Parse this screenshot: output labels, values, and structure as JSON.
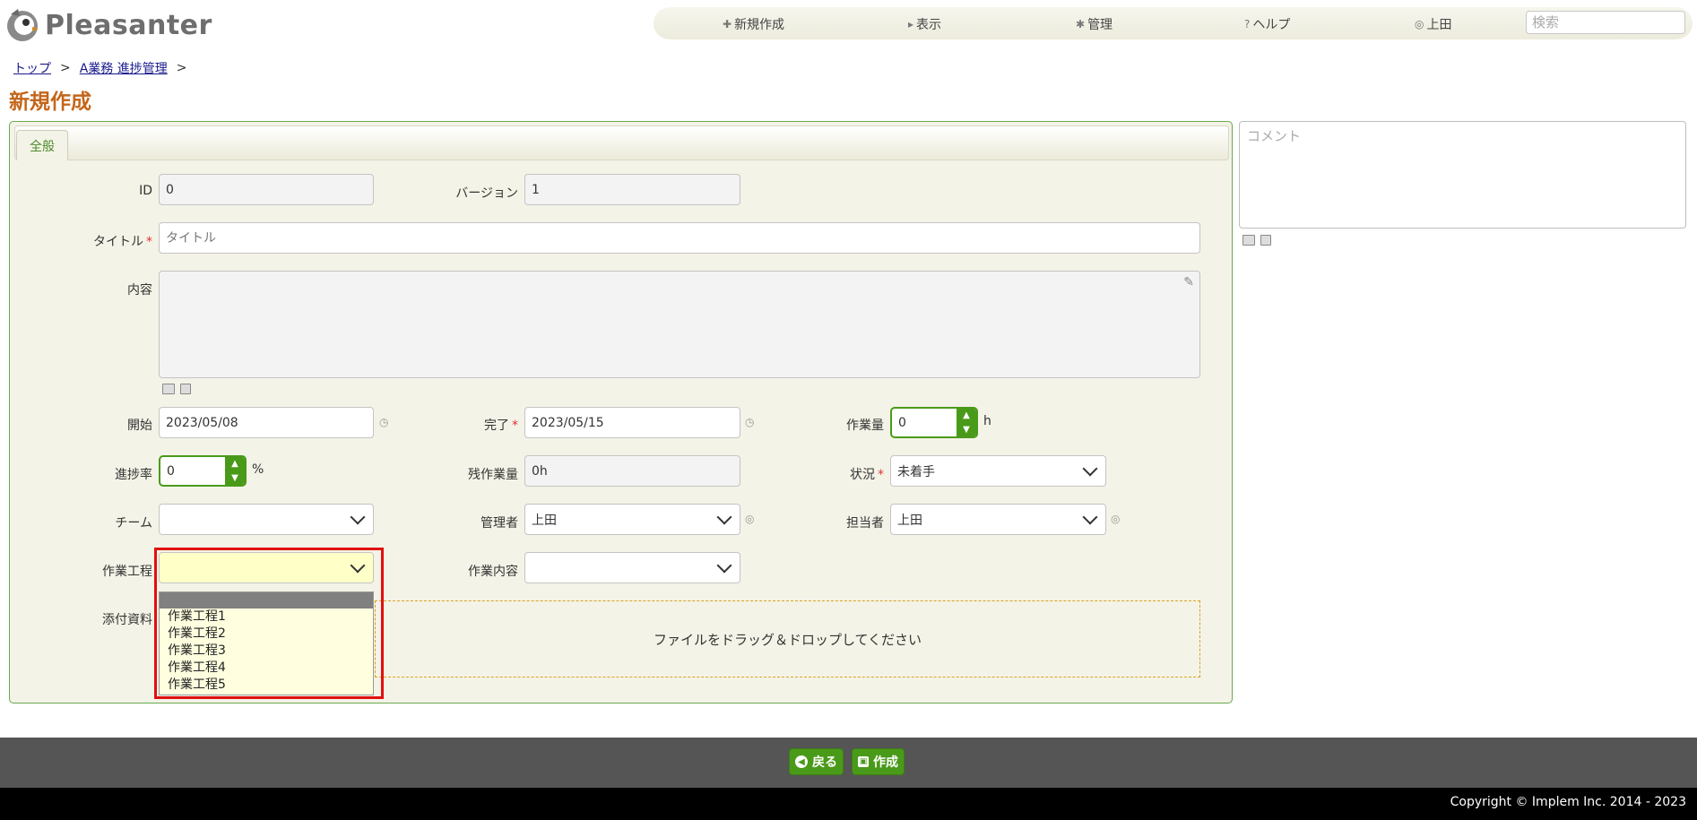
{
  "header": {
    "logo_text": "Pleasanter",
    "nav": {
      "new": {
        "label": "新規作成",
        "icon": "plus-icon"
      },
      "view": {
        "label": "表示",
        "icon": "triangle-right-icon"
      },
      "admin": {
        "label": "管理",
        "icon": "gear-icon"
      },
      "help": {
        "label": "ヘルプ",
        "icon": "question-icon"
      },
      "user": {
        "label": "上田",
        "icon": "person-icon"
      }
    },
    "search_placeholder": "検索"
  },
  "breadcrumb": {
    "top": "トップ",
    "site": "A業務 進捗管理",
    "sep": ">"
  },
  "page_title": "新規作成",
  "tabs": {
    "general": "全般"
  },
  "form": {
    "id": {
      "label": "ID",
      "value": "0"
    },
    "version": {
      "label": "バージョン",
      "value": "1"
    },
    "title": {
      "label": "タイトル",
      "required_mark": "*",
      "placeholder": "タイトル"
    },
    "body": {
      "label": "内容"
    },
    "start": {
      "label": "開始",
      "value": "2023/05/08"
    },
    "complete": {
      "label": "完了",
      "required_mark": "*",
      "value": "2023/05/15"
    },
    "workload": {
      "label": "作業量",
      "value": "0",
      "unit": "h"
    },
    "progress": {
      "label": "進捗率",
      "value": "0",
      "unit": "%"
    },
    "remaining": {
      "label": "残作業量",
      "value": "0h"
    },
    "status": {
      "label": "状況",
      "required_mark": "*",
      "value": "未着手"
    },
    "team": {
      "label": "チーム",
      "value": ""
    },
    "manager": {
      "label": "管理者",
      "value": "上田"
    },
    "owner": {
      "label": "担当者",
      "value": "上田"
    },
    "process": {
      "label": "作業工程",
      "value": "",
      "options": [
        "",
        "作業工程1",
        "作業工程2",
        "作業工程3",
        "作業工程4",
        "作業工程5"
      ]
    },
    "work_content": {
      "label": "作業内容",
      "value": ""
    },
    "attachments": {
      "label": "添付資料",
      "drop_text": "ファイルをドラッグ＆ドロップしてください"
    }
  },
  "comment": {
    "placeholder": "コメント"
  },
  "footer": {
    "back": "戻る",
    "create": "作成",
    "copyright": "Copyright © Implem Inc. 2014 - 2023"
  },
  "colors": {
    "accent_green": "#4a9a1a",
    "title_orange": "#c4661a",
    "highlight_red": "#e01010"
  }
}
